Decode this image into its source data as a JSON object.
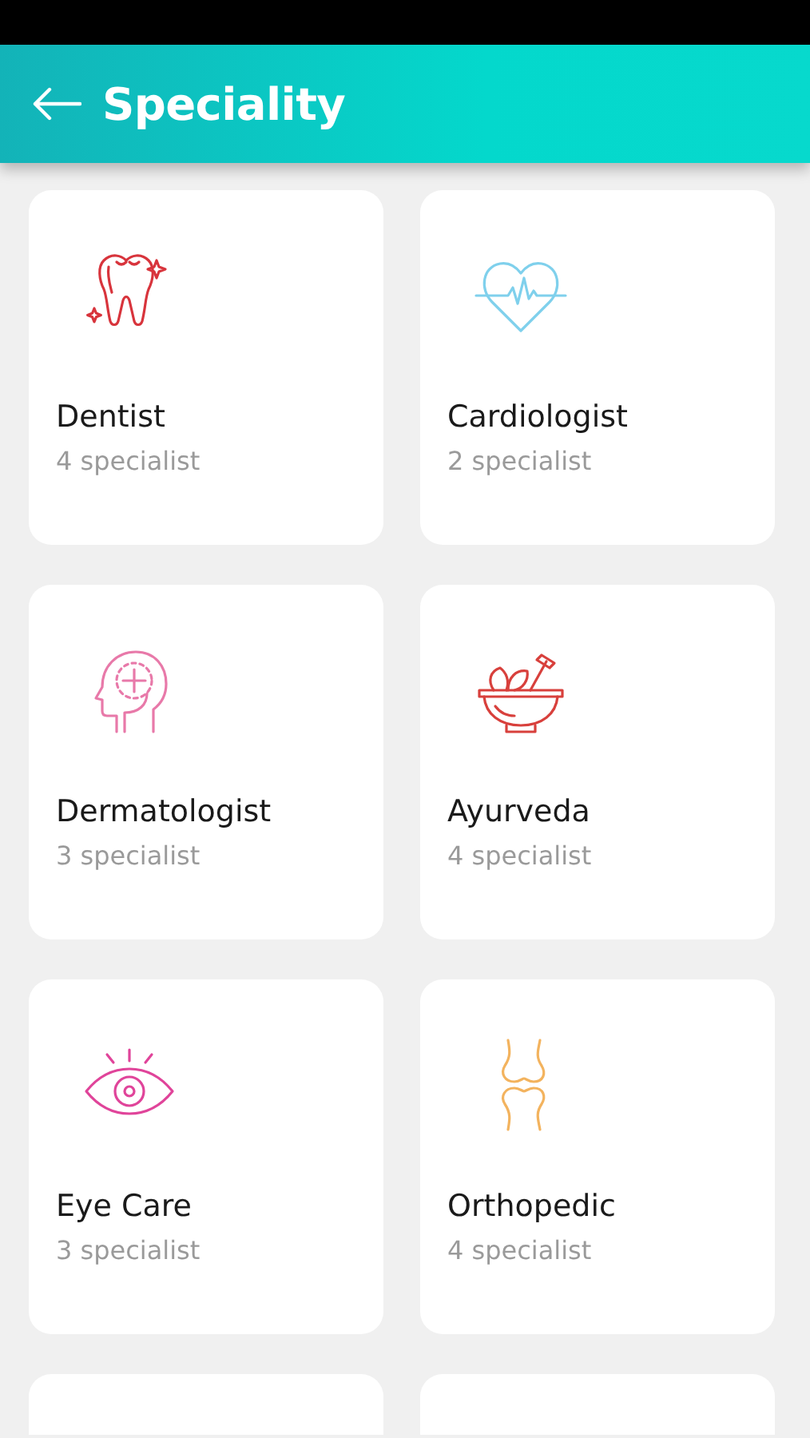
{
  "header": {
    "title": "Speciality"
  },
  "specialities": [
    {
      "name": "Dentist",
      "count": "4 specialist",
      "kind": "tooth",
      "color": "#d8343c"
    },
    {
      "name": "Cardiologist",
      "count": "2 specialist",
      "kind": "heart",
      "color": "#7fd0ec"
    },
    {
      "name": "Dermatologist",
      "count": "3 specialist",
      "kind": "head",
      "color": "#e879a9"
    },
    {
      "name": "Ayurveda",
      "count": "4 specialist",
      "kind": "bowl",
      "color": "#d8403c"
    },
    {
      "name": "Eye Care",
      "count": "3 specialist",
      "kind": "eye",
      "color": "#e0449a"
    },
    {
      "name": "Orthopedic",
      "count": "4 specialist",
      "kind": "knee",
      "color": "#f3b35e"
    }
  ]
}
